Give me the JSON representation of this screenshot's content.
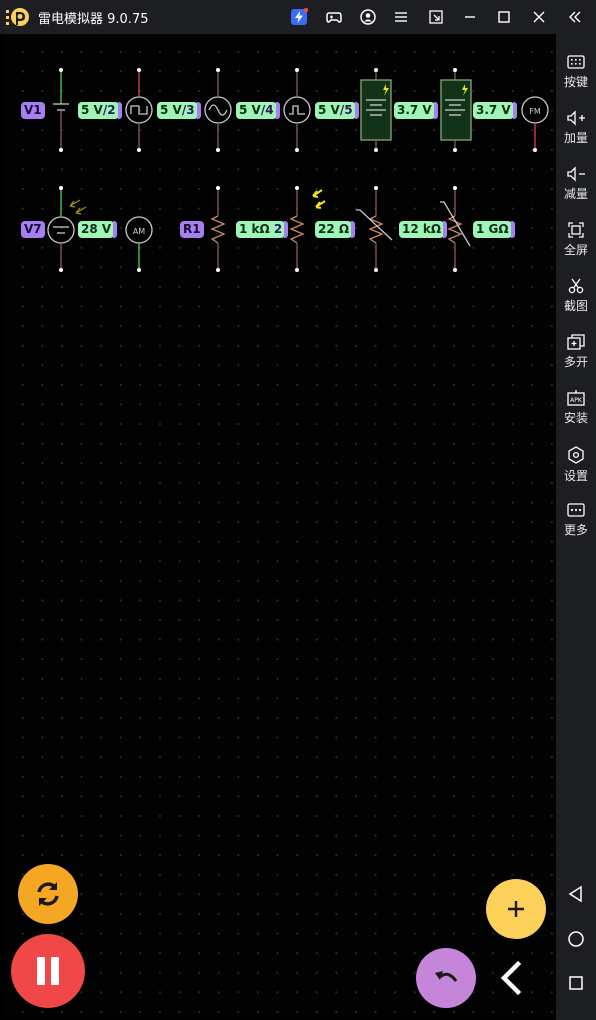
{
  "window": {
    "title": "雷电模拟器 9.0.75"
  },
  "sidebar": {
    "items": [
      {
        "label": "按键",
        "icon": "keyboard-icon"
      },
      {
        "label": "加量",
        "icon": "volume-up-icon"
      },
      {
        "label": "减量",
        "icon": "volume-down-icon"
      },
      {
        "label": "全屏",
        "icon": "fullscreen-icon"
      },
      {
        "label": "截图",
        "icon": "scissors-icon"
      },
      {
        "label": "多开",
        "icon": "multi-instance-icon"
      },
      {
        "label": "安装",
        "icon": "apk-install-icon"
      },
      {
        "label": "设置",
        "icon": "settings-icon"
      },
      {
        "label": "更多",
        "icon": "more-icon"
      }
    ]
  },
  "circuit": {
    "row1": {
      "tag_v1": "V1",
      "src1_value": "5 V",
      "src1_id": "/2",
      "src2_value": "5 V",
      "src2_id": "/3",
      "src3_value": "5 V",
      "src3_id": "/4",
      "src4_value": "5 V",
      "src4_id": "/5",
      "battery1_value": "3.7 V",
      "battery2_value": "3.7 V",
      "fm_label": "FM"
    },
    "row2": {
      "tag_v7": "V7",
      "solar_value": "28 V",
      "am_label": "AM",
      "tag_r1": "R1",
      "res1_value": "1 kΩ",
      "res1_id": "2",
      "ldr_value": "22 Ω",
      "thermistor_value": "12 kΩ",
      "varistor_value": "1 GΩ"
    }
  },
  "colors": {
    "accent_green": "#9ff5b6",
    "accent_purple": "#a77ff0",
    "pause_red": "#f04848",
    "rotate_orange": "#f5a623",
    "add_yellow": "#fdd05a",
    "undo_violet": "#c586d9"
  }
}
